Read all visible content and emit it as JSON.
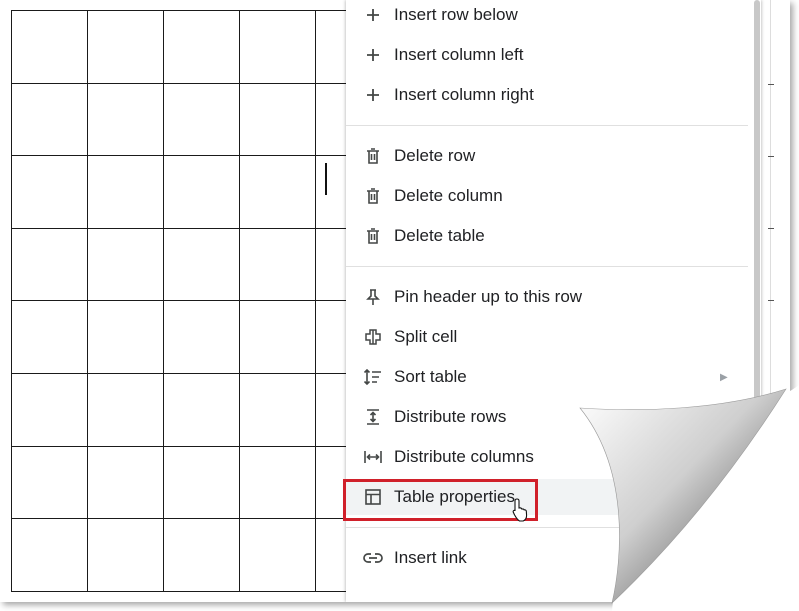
{
  "context_menu": {
    "items": [
      {
        "label": "Insert row below",
        "icon": "plus-icon"
      },
      {
        "label": "Insert column left",
        "icon": "plus-icon"
      },
      {
        "label": "Insert column right",
        "icon": "plus-icon"
      },
      {
        "label": "Delete row",
        "icon": "trash-icon"
      },
      {
        "label": "Delete column",
        "icon": "trash-icon"
      },
      {
        "label": "Delete table",
        "icon": "trash-icon"
      },
      {
        "label": "Pin header up to this row",
        "icon": "pin-icon"
      },
      {
        "label": "Split cell",
        "icon": "split-cell-icon"
      },
      {
        "label": "Sort table",
        "icon": "sort-icon",
        "has_submenu": true
      },
      {
        "label": "Distribute rows",
        "icon": "distribute-rows-icon"
      },
      {
        "label": "Distribute columns",
        "icon": "distribute-columns-icon"
      },
      {
        "label": "Table properties",
        "icon": "table-icon",
        "highlighted": true
      },
      {
        "label": "Insert link",
        "icon": "link-icon"
      }
    ]
  },
  "colors": {
    "highlight_box": "#d0202a",
    "menu_text": "#202124",
    "menu_icon": "#444746",
    "hover_background": "#f1f3f4"
  }
}
